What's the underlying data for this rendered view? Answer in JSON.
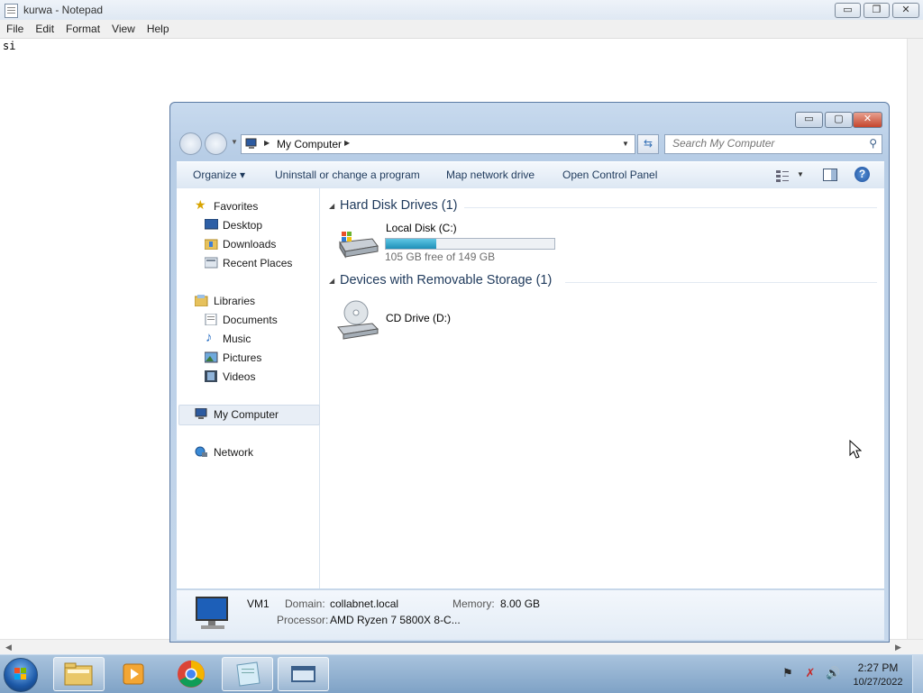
{
  "notepad": {
    "title": "kurwa - Notepad",
    "menu": [
      "File",
      "Edit",
      "Format",
      "View",
      "Help"
    ],
    "content": "si",
    "controls": {
      "minimize": "▭",
      "maximize": "❐",
      "close": "✕"
    }
  },
  "explorer": {
    "controls": {
      "minimize": "▭",
      "maximize": "▢",
      "close": "✕"
    },
    "address": {
      "location": "My Computer"
    },
    "search": {
      "placeholder": "Search My Computer"
    },
    "toolbar": {
      "organize": "Organize ▾",
      "uninstall": "Uninstall or change a program",
      "map_drive": "Map network drive",
      "control_panel": "Open Control Panel",
      "help": "?"
    },
    "nav": {
      "favorites": "Favorites",
      "desktop": "Desktop",
      "downloads": "Downloads",
      "recent": "Recent Places",
      "libraries": "Libraries",
      "documents": "Documents",
      "music": "Music",
      "pictures": "Pictures",
      "videos": "Videos",
      "my_computer": "My Computer",
      "network": "Network"
    },
    "groups": {
      "hdd": {
        "title": "Hard Disk Drives (1)",
        "drive_name": "Local Disk (C:)",
        "free_text": "105 GB free of 149 GB",
        "used_fraction": 0.3
      },
      "removable": {
        "title": "Devices with Removable Storage (1)",
        "drive_name": "CD Drive (D:)"
      }
    },
    "details": {
      "name": "VM1",
      "domain_label": "Domain:",
      "domain": "collabnet.local",
      "memory_label": "Memory:",
      "memory": "8.00 GB",
      "processor_label": "Processor:",
      "processor": "AMD Ryzen 7 5800X 8-C..."
    }
  },
  "taskbar": {
    "time": "2:27 PM",
    "date": "10/27/2022",
    "accent": "#1d59a7"
  }
}
